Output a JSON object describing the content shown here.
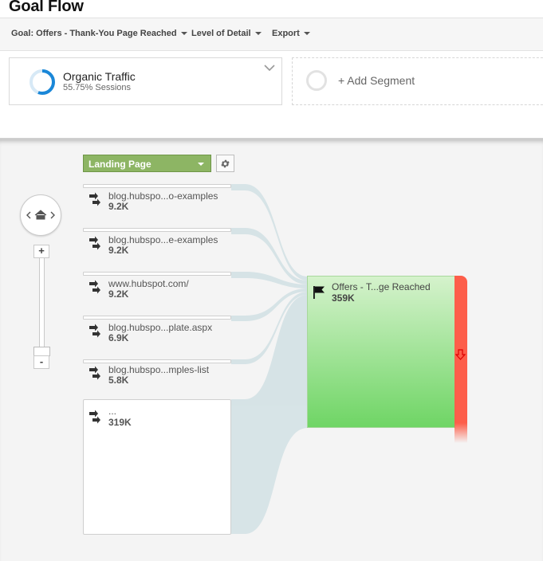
{
  "header": {
    "title": "Goal Flow"
  },
  "toolbar": {
    "goal_label": "Goal: Offers - Thank-You Page Reached",
    "detail_label": "Level of Detail",
    "export_label": "Export"
  },
  "segments": {
    "active": {
      "name": "Organic Traffic",
      "sessions": "55.75% Sessions",
      "percent": 55.75,
      "color": "#1a87d8"
    },
    "add_label": "+ Add Segment"
  },
  "flow": {
    "dimension_label": "Landing Page",
    "nodes": [
      {
        "label": "blog.hubspo...o-examples",
        "value": "9.2K"
      },
      {
        "label": "blog.hubspo...e-examples",
        "value": "9.2K"
      },
      {
        "label": "www.hubspot.com/",
        "value": "9.2K"
      },
      {
        "label": "blog.hubspo...plate.aspx",
        "value": "6.9K"
      },
      {
        "label": "blog.hubspo...mples-list",
        "value": "5.8K"
      },
      {
        "label": "...",
        "value": "319K"
      }
    ],
    "goal": {
      "label": "Offers - T...ge Reached",
      "value": "359K",
      "color": "#6fd565",
      "exit_color": "#fd5e4a"
    }
  },
  "zoom": {
    "plus_label": "+",
    "minus_label": "-"
  }
}
